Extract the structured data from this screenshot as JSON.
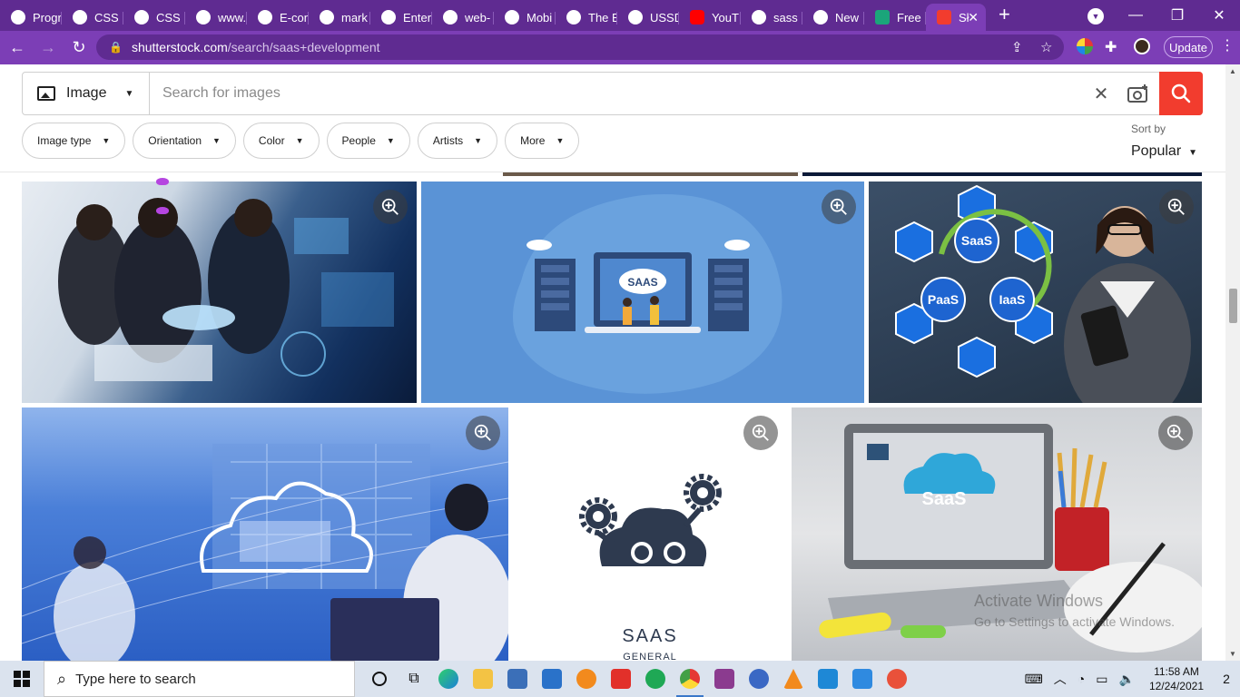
{
  "browser": {
    "tabs": [
      {
        "title": "Progr",
        "icon": "globe-icon"
      },
      {
        "title": "CSS I",
        "icon": "globe-icon"
      },
      {
        "title": "CSS b",
        "icon": "globe-icon"
      },
      {
        "title": "www.",
        "icon": "globe-icon"
      },
      {
        "title": "E-con",
        "icon": "globe-icon"
      },
      {
        "title": "mark",
        "icon": "globe-icon"
      },
      {
        "title": "Enter",
        "icon": "globe-icon"
      },
      {
        "title": "web-",
        "icon": "globe-icon"
      },
      {
        "title": "Mobi",
        "icon": "globe-icon"
      },
      {
        "title": "The B",
        "icon": "globe-icon"
      },
      {
        "title": "USSD",
        "icon": "globe-icon"
      },
      {
        "title": "YouT",
        "icon": "youtube-icon"
      },
      {
        "title": "sass",
        "icon": "globe-icon"
      },
      {
        "title": "New",
        "icon": "chrome-icon"
      },
      {
        "title": "Free",
        "icon": "dribbble-icon"
      },
      {
        "title": "Sł",
        "icon": "shutterstock-icon",
        "active": true
      }
    ],
    "url_host": "shutterstock.com",
    "url_path": "/search/saas+development",
    "update_label": "Update",
    "theme": {
      "frame": "#5f2b91",
      "toolbar": "#7c3eb6"
    }
  },
  "search": {
    "type_label": "Image",
    "placeholder": "Search for images",
    "accent": "#f23c2e"
  },
  "filters": [
    {
      "label": "Image type"
    },
    {
      "label": "Orientation"
    },
    {
      "label": "Color"
    },
    {
      "label": "People"
    },
    {
      "label": "Artists"
    },
    {
      "label": "More"
    }
  ],
  "sort": {
    "label": "Sort by",
    "value": "Popular"
  },
  "results": {
    "row1": [
      {
        "desc": "business-team-technology-icon"
      },
      {
        "desc": "saas-servers-illustration-icon"
      },
      {
        "desc": "saas-paas-iaas-businesswoman-icon"
      }
    ],
    "row2": [
      {
        "desc": "cloud-computing-office-icon"
      },
      {
        "desc": "saas-cloud-gears-logo",
        "caption": "SAAS",
        "subcaption": "GENERAL"
      },
      {
        "desc": "saas-laptop-desk-icon"
      }
    ],
    "art_text": {
      "saas_server": "SAAS",
      "saas_cycle": "SaaS",
      "paas_cycle": "PaaS",
      "iaas_cycle": "IaaS",
      "saas_laptop": "SaaS"
    }
  },
  "watermark": {
    "line1": "Activate Windows",
    "line2": "Go to Settings to activate Windows."
  },
  "taskbar": {
    "search_label": "Type here to search",
    "time": "11:58 AM",
    "date": "12/24/2021",
    "notifications": "2"
  }
}
